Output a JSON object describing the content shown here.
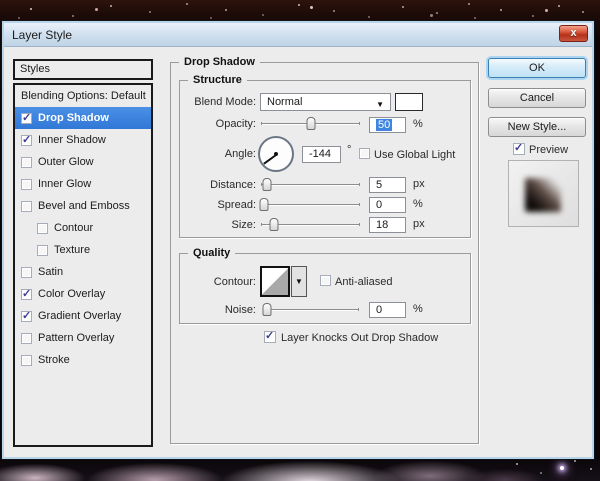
{
  "window": {
    "title": "Layer Style",
    "close_glyph": "x"
  },
  "sidebar": {
    "header": "Styles",
    "blending": "Blending Options: Default",
    "items": [
      {
        "label": "Drop Shadow",
        "checked": true,
        "selected": true,
        "indent": false
      },
      {
        "label": "Inner Shadow",
        "checked": true,
        "selected": false,
        "indent": false
      },
      {
        "label": "Outer Glow",
        "checked": false,
        "selected": false,
        "indent": false
      },
      {
        "label": "Inner Glow",
        "checked": false,
        "selected": false,
        "indent": false
      },
      {
        "label": "Bevel and Emboss",
        "checked": false,
        "selected": false,
        "indent": false
      },
      {
        "label": "Contour",
        "checked": false,
        "selected": false,
        "indent": true
      },
      {
        "label": "Texture",
        "checked": false,
        "selected": false,
        "indent": true
      },
      {
        "label": "Satin",
        "checked": false,
        "selected": false,
        "indent": false
      },
      {
        "label": "Color Overlay",
        "checked": true,
        "selected": false,
        "indent": false
      },
      {
        "label": "Gradient Overlay",
        "checked": true,
        "selected": false,
        "indent": false
      },
      {
        "label": "Pattern Overlay",
        "checked": false,
        "selected": false,
        "indent": false
      },
      {
        "label": "Stroke",
        "checked": false,
        "selected": false,
        "indent": false
      }
    ]
  },
  "panel": {
    "title": "Drop Shadow",
    "structure": {
      "legend": "Structure",
      "blend_mode": {
        "label": "Blend Mode:",
        "value": "Normal"
      },
      "opacity": {
        "label": "Opacity:",
        "value": "50",
        "unit": "%"
      },
      "angle": {
        "label": "Angle:",
        "value": "-144",
        "unit": "°",
        "global_light_label": "Use Global Light",
        "global_light_checked": false
      },
      "distance": {
        "label": "Distance:",
        "value": "5",
        "unit": "px"
      },
      "spread": {
        "label": "Spread:",
        "value": "0",
        "unit": "%"
      },
      "size": {
        "label": "Size:",
        "value": "18",
        "unit": "px"
      }
    },
    "quality": {
      "legend": "Quality",
      "contour_label": "Contour:",
      "anti_aliased_label": "Anti-aliased",
      "anti_aliased_checked": false,
      "noise": {
        "label": "Noise:",
        "value": "0",
        "unit": "%"
      }
    },
    "knockout_label": "Layer Knocks Out Drop Shadow",
    "knockout_checked": true
  },
  "actions": {
    "ok": "OK",
    "cancel": "Cancel",
    "new_style": "New Style...",
    "preview_label": "Preview",
    "preview_checked": true
  },
  "colors": {
    "selection_blue": "#3f86e0",
    "titlebar_blue": "#d3e2f0",
    "close_red": "#b53018"
  }
}
